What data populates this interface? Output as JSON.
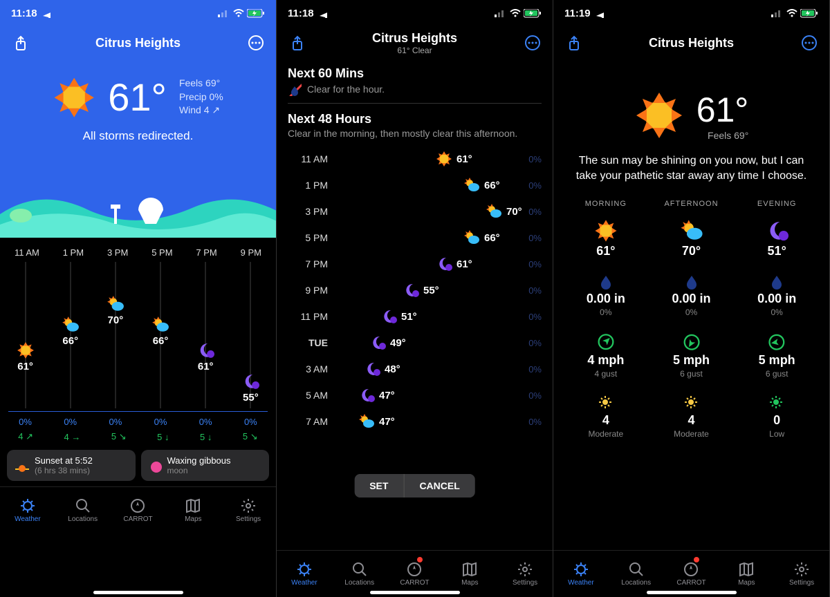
{
  "status": {
    "time1": "11:18",
    "time2": "11:18",
    "time3": "11:19"
  },
  "location": "Citrus Heights",
  "screen1": {
    "temp": "61°",
    "feels": "Feels 69°",
    "precip": "Precip 0%",
    "wind": "Wind 4 ↗",
    "message": "All storms redirected.",
    "hourly": [
      {
        "time": "11 AM",
        "icon": "sun",
        "temp": "61°",
        "precip": "0%",
        "wind": "4 ↗",
        "offset": 115
      },
      {
        "time": "1 PM",
        "icon": "partly",
        "temp": "66°",
        "precip": "0%",
        "wind": "4 →",
        "offset": 78
      },
      {
        "time": "3 PM",
        "icon": "partly",
        "temp": "70°",
        "precip": "0%",
        "wind": "5 ↘",
        "offset": 48
      },
      {
        "time": "5 PM",
        "icon": "partly",
        "temp": "66°",
        "precip": "0%",
        "wind": "5 ↓",
        "offset": 78
      },
      {
        "time": "7 PM",
        "icon": "moon",
        "temp": "61°",
        "precip": "0%",
        "wind": "5 ↓",
        "offset": 115
      },
      {
        "time": "9 PM",
        "icon": "moon",
        "temp": "55°",
        "precip": "0%",
        "wind": "5 ↘",
        "offset": 160
      }
    ],
    "pill1_line1": "Sunset at 5:52",
    "pill1_line2": "(6 hrs 38 mins)",
    "pill2_line1": "Waxing gibbous",
    "pill2_line2": "moon"
  },
  "screen2": {
    "subtitle": "61° Clear",
    "next60_h": "Next 60 Mins",
    "next60_sub": "Clear for the hour.",
    "next48_h": "Next 48 Hours",
    "next48_sub": "Clear in the morning, then mostly clear this afternoon.",
    "rows": [
      {
        "time": "11 AM",
        "icon": "sun",
        "temp": "61°",
        "precip": "0%",
        "pos": 150
      },
      {
        "time": "1 PM",
        "icon": "partly",
        "temp": "66°",
        "precip": "0%",
        "pos": 190
      },
      {
        "time": "3 PM",
        "icon": "partly",
        "temp": "70°",
        "precip": "0%",
        "pos": 222
      },
      {
        "time": "5 PM",
        "icon": "partly",
        "temp": "66°",
        "precip": "0%",
        "pos": 190
      },
      {
        "time": "7 PM",
        "icon": "moon",
        "temp": "61°",
        "precip": "0%",
        "pos": 150
      },
      {
        "time": "9 PM",
        "icon": "moon",
        "temp": "55°",
        "precip": "0%",
        "pos": 102
      },
      {
        "time": "11 PM",
        "icon": "moon",
        "temp": "51°",
        "precip": "0%",
        "pos": 70
      },
      {
        "time": "TUE",
        "icon": "moon",
        "temp": "49°",
        "precip": "0%",
        "pos": 54,
        "bold": true
      },
      {
        "time": "3 AM",
        "icon": "moon",
        "temp": "48°",
        "precip": "0%",
        "pos": 46
      },
      {
        "time": "5 AM",
        "icon": "moon",
        "temp": "47°",
        "precip": "0%",
        "pos": 38
      },
      {
        "time": "7 AM",
        "icon": "partly",
        "temp": "47°",
        "precip": "0%",
        "pos": 38
      }
    ],
    "set_label": "SET",
    "cancel_label": "CANCEL"
  },
  "screen3": {
    "temp": "61°",
    "feels": "Feels 69°",
    "message": "The sun may be shining on you now, but I can take your pathetic star away any time I choose.",
    "periods": [
      {
        "label": "MORNING",
        "icon": "sun",
        "temp": "61°",
        "rain": "0.00 in",
        "rainpct": "0%",
        "wind": "4 mph",
        "gust": "4 gust",
        "uv": "4",
        "uvlabel": "Moderate",
        "windrot": 45,
        "uvcolor": "#f6c945"
      },
      {
        "label": "AFTERNOON",
        "icon": "partly",
        "temp": "70°",
        "rain": "0.00 in",
        "rainpct": "0%",
        "wind": "5 mph",
        "gust": "6 gust",
        "uv": "4",
        "uvlabel": "Moderate",
        "windrot": 210,
        "uvcolor": "#f6c945"
      },
      {
        "label": "EVENING",
        "icon": "moon",
        "temp": "51°",
        "rain": "0.00 in",
        "rainpct": "0%",
        "wind": "5 mph",
        "gust": "6 gust",
        "uv": "0",
        "uvlabel": "Low",
        "windrot": 260,
        "uvcolor": "#22c55e"
      }
    ]
  },
  "tabs": [
    {
      "label": "Weather",
      "icon": "weather"
    },
    {
      "label": "Locations",
      "icon": "search"
    },
    {
      "label": "CARROT",
      "icon": "carrot"
    },
    {
      "label": "Maps",
      "icon": "map"
    },
    {
      "label": "Settings",
      "icon": "settings"
    }
  ]
}
